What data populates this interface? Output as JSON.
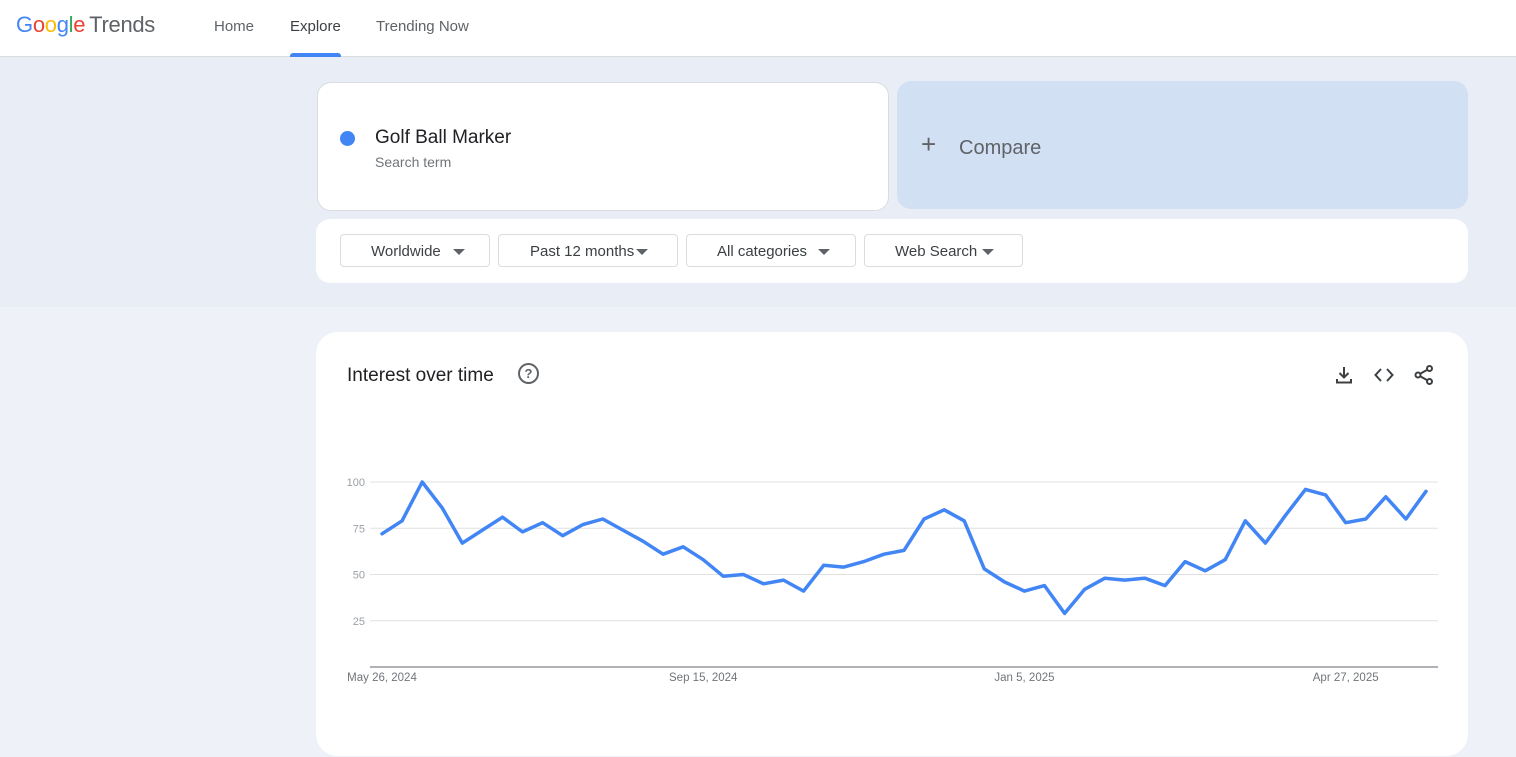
{
  "header": {
    "logo_google": [
      "G",
      "o",
      "o",
      "g",
      "l",
      "e"
    ],
    "logo_trends": "Trends",
    "tabs": [
      {
        "label": "Home"
      },
      {
        "label": "Explore"
      },
      {
        "label": "Trending Now"
      }
    ],
    "active_tab": "Explore"
  },
  "search_term": {
    "title": "Golf Ball Marker",
    "subtitle": "Search term",
    "color": "#4285f4"
  },
  "compare": {
    "plus": "+",
    "label": "Compare"
  },
  "filters": [
    {
      "label": "Worldwide"
    },
    {
      "label": "Past 12 months"
    },
    {
      "label": "All categories"
    },
    {
      "label": "Web Search"
    }
  ],
  "chart_section": {
    "title": "Interest over time",
    "help_icon": "?",
    "icons": [
      "download-icon",
      "embed-icon",
      "share-icon"
    ]
  },
  "chart_data": {
    "type": "line",
    "series": [
      {
        "name": "Golf Ball Marker",
        "color": "#4285f4",
        "values": [
          72,
          79,
          100,
          86,
          67,
          74,
          81,
          73,
          78,
          71,
          77,
          80,
          74,
          68,
          61,
          65,
          58,
          49,
          50,
          45,
          47,
          41,
          55,
          54,
          57,
          61,
          63,
          80,
          85,
          79,
          53,
          46,
          41,
          44,
          29,
          42,
          48,
          47,
          48,
          44,
          57,
          52,
          58,
          79,
          67,
          82,
          96,
          93,
          78,
          80,
          92,
          80,
          95
        ]
      }
    ],
    "x_tick_labels": [
      "May 26, 2024",
      "Sep 15, 2024",
      "Jan 5, 2025",
      "Apr 27, 2025"
    ],
    "x_tick_indices": [
      0,
      16,
      32,
      48
    ],
    "y_ticks": [
      25,
      50,
      75,
      100
    ],
    "ylim": [
      0,
      100
    ],
    "grid": true
  }
}
